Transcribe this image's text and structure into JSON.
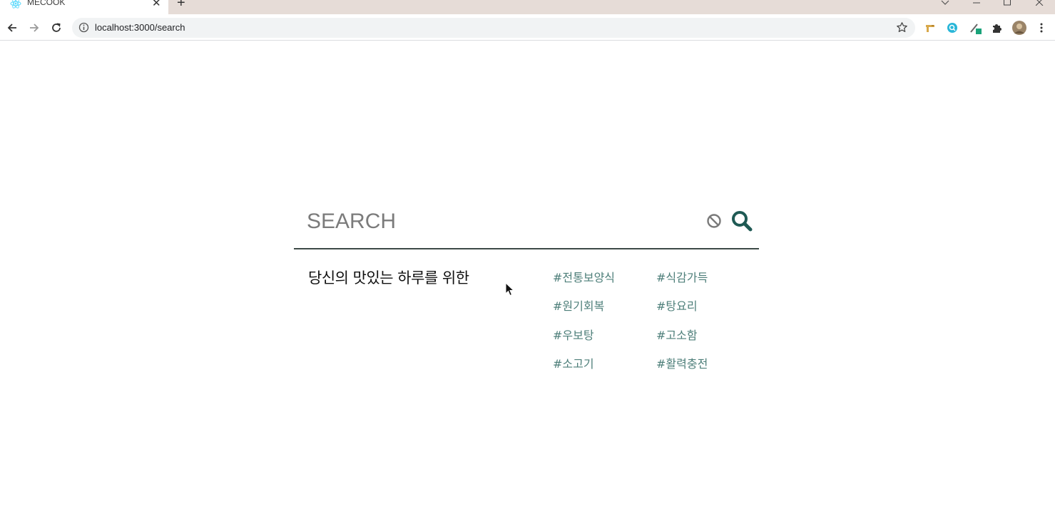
{
  "browser": {
    "tab": {
      "title": "MECOOK",
      "favicon": "react-icon"
    },
    "address": {
      "url": "localhost:3000/search"
    },
    "icons": {
      "back": "arrow-left-icon",
      "forward": "arrow-right-icon",
      "reload": "reload-icon",
      "info": "info-icon",
      "star": "star-icon"
    }
  },
  "search": {
    "placeholder": "SEARCH",
    "value": ""
  },
  "tagline": "당신의 맛있는 하루를 위한",
  "tags": [
    "#전통보양식",
    "#식감가득",
    "#원기회복",
    "#탕요리",
    "#우보탕",
    "#고소함",
    "#소고기",
    "#활력충전"
  ],
  "colors": {
    "accent": "#1f5a54",
    "tag": "#4e7f7a",
    "underline": "#3d4a47"
  }
}
